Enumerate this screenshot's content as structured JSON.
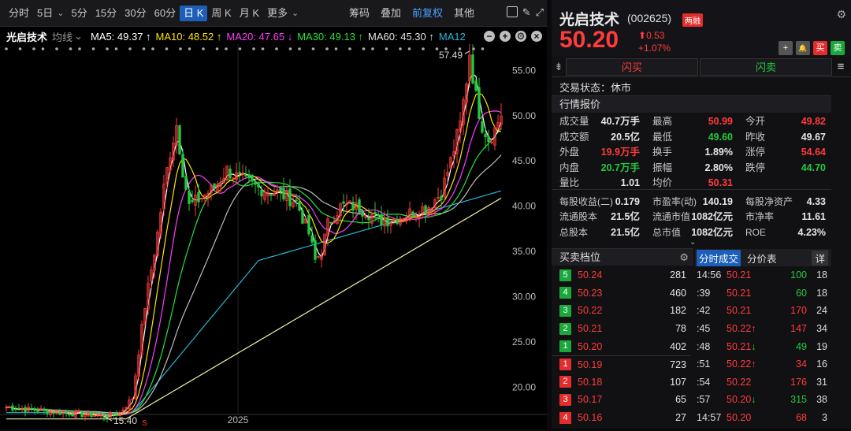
{
  "toolbar": {
    "periods": [
      "分时",
      "5日",
      "5分",
      "15分",
      "30分",
      "60分",
      "日 K",
      "周 K",
      "月 K",
      "更多"
    ],
    "active": "日 K",
    "right": [
      "筹码",
      "叠加",
      "前复权",
      "其他"
    ]
  },
  "ma": {
    "name": "光启技术",
    "type": "均线",
    "ma5": "MA5: 49.37 ↑",
    "ma10": "MA10: 48.52 ↑",
    "ma20": "MA20: 47.65 ↓",
    "ma30": "MA30: 49.13 ↑",
    "ma60": "MA60: 45.30 ↑",
    "ma120": "MA12"
  },
  "chart_data": {
    "type": "candlestick",
    "y_ticks": [
      "55.00",
      "50.00",
      "45.00",
      "40.00",
      "35.00",
      "30.00",
      "25.00",
      "20.00"
    ],
    "ylim": [
      17,
      57.9
    ],
    "high_label": "57.49",
    "low_label": "15.40",
    "x_label": "2025",
    "last_price": 50.2
  },
  "colors": {
    "up": "#ff3b3b",
    "down": "#23c93e",
    "ma5": "#ffffff",
    "ma10": "#ffe600",
    "ma20": "#ff3bff",
    "ma30": "#23e33b",
    "ma60": "#bdbdbd",
    "ma120": "#25b8d6",
    "ma250": "#f2f0a0"
  },
  "stock": {
    "name": "光启技术",
    "code": "(002625)",
    "badge": "两融",
    "price": "50.20",
    "chg": "0.53",
    "pct": "+1.07%"
  },
  "buttons": {
    "add": "+",
    "alert": "🔔",
    "buy": "买",
    "sell": "卖"
  },
  "flash": {
    "buy": "闪买",
    "sell": "闪卖"
  },
  "status": "交易状态：休市",
  "quote_title": "行情报价",
  "quote": [
    [
      [
        "成交量",
        "40.7万手",
        "white"
      ],
      [
        "最高",
        "50.99",
        "red"
      ],
      [
        "今开",
        "49.82",
        "red"
      ]
    ],
    [
      [
        "成交额",
        "20.5亿",
        "white"
      ],
      [
        "最低",
        "49.60",
        "green"
      ],
      [
        "昨收",
        "49.67",
        "white"
      ]
    ],
    [
      [
        "外盘",
        "19.9万手",
        "red"
      ],
      [
        "换手",
        "1.89%",
        "white"
      ],
      [
        "涨停",
        "54.64",
        "red"
      ]
    ],
    [
      [
        "内盘",
        "20.7万手",
        "green"
      ],
      [
        "振幅",
        "2.80%",
        "white"
      ],
      [
        "跌停",
        "44.70",
        "green"
      ]
    ],
    [
      [
        "量比",
        "1.01",
        "white"
      ],
      [
        "均价",
        "50.31",
        "red"
      ],
      [
        "",
        "",
        " "
      ]
    ],
    [
      [
        "每股收益(二)",
        "0.179",
        "white"
      ],
      [
        "市盈率(动)",
        "140.19",
        "white"
      ],
      [
        "每股净资产",
        "4.33",
        "white"
      ]
    ],
    [
      [
        "流通股本",
        "21.5亿",
        "white"
      ],
      [
        "流通市值",
        "1082亿元",
        "white"
      ],
      [
        "市净率",
        "11.61",
        "white"
      ]
    ],
    [
      [
        "总股本",
        "21.5亿",
        "white"
      ],
      [
        "总市值",
        "1082亿元",
        "white"
      ],
      [
        "ROE",
        "4.23%",
        "white"
      ]
    ]
  ],
  "orderbook_title": "买卖档位",
  "ts_tabs": {
    "a": "分时成交",
    "b": "分价表",
    "c": "详"
  },
  "orderbook": [
    {
      "n": "5",
      "p": "50.24",
      "v": "281",
      "side": "sell"
    },
    {
      "n": "4",
      "p": "50.23",
      "v": "460",
      "side": "sell"
    },
    {
      "n": "3",
      "p": "50.22",
      "v": "182",
      "side": "sell"
    },
    {
      "n": "2",
      "p": "50.21",
      "v": "78",
      "side": "sell"
    },
    {
      "n": "1",
      "p": "50.20",
      "v": "402",
      "side": "sell"
    },
    {
      "n": "1",
      "p": "50.19",
      "v": "723",
      "side": "buy"
    },
    {
      "n": "2",
      "p": "50.18",
      "v": "107",
      "side": "buy"
    },
    {
      "n": "3",
      "p": "50.17",
      "v": "65",
      "side": "buy"
    },
    {
      "n": "4",
      "p": "50.16",
      "v": "27",
      "side": "buy"
    }
  ],
  "trades": [
    {
      "t": "14:56",
      "p": "50.21",
      "a": "",
      "v": "100",
      "vc": "green",
      "c": "18"
    },
    {
      "t": ":39",
      "p": "50.21",
      "a": "",
      "v": "60",
      "vc": "green",
      "c": "18"
    },
    {
      "t": ":42",
      "p": "50.21",
      "a": "",
      "v": "170",
      "vc": "red",
      "c": "24"
    },
    {
      "t": ":45",
      "p": "50.22",
      "a": "↑",
      "v": "147",
      "vc": "red",
      "c": "34"
    },
    {
      "t": ":48",
      "p": "50.21",
      "a": "↓",
      "v": "49",
      "vc": "green",
      "c": "19"
    },
    {
      "t": ":51",
      "p": "50.22",
      "a": "↑",
      "v": "34",
      "vc": "red",
      "c": "16"
    },
    {
      "t": ":54",
      "p": "50.22",
      "a": "",
      "v": "176",
      "vc": "red",
      "c": "31"
    },
    {
      "t": ":57",
      "p": "50.20",
      "a": "↓",
      "v": "315",
      "vc": "green",
      "c": "38"
    },
    {
      "t": "14:57",
      "p": "50.20",
      "a": "",
      "v": "68",
      "vc": "red",
      "c": "3"
    }
  ]
}
